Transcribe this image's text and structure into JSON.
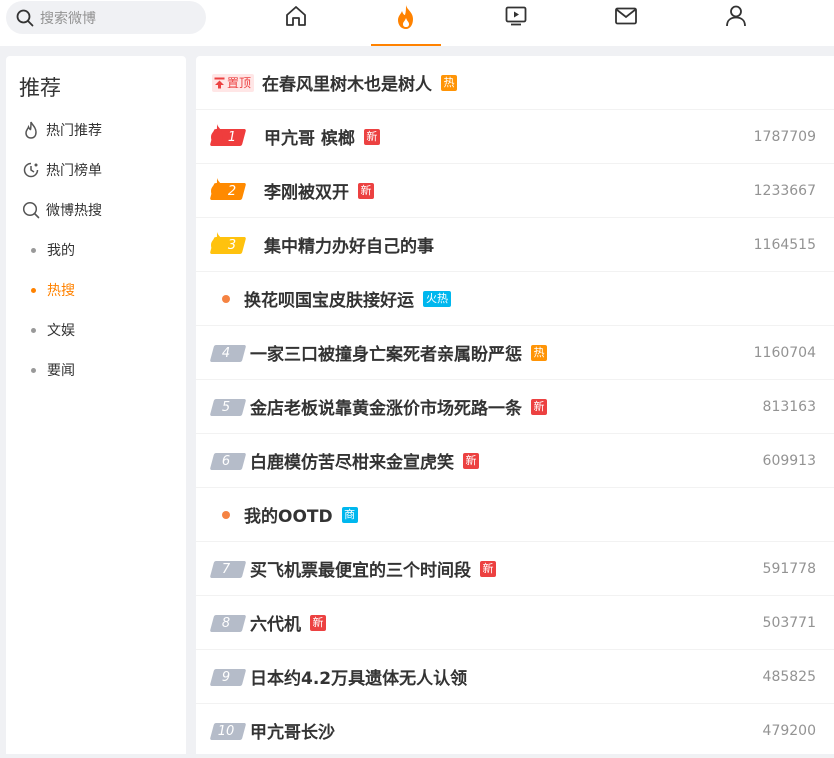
{
  "search": {
    "placeholder": "搜索微博"
  },
  "nav": {
    "icons": [
      "home-icon",
      "hot-fire-icon",
      "video-icon",
      "message-icon",
      "profile-icon"
    ],
    "active": "hot-fire-icon"
  },
  "sidebar": {
    "title": "推荐",
    "items": [
      {
        "label": "热门推荐",
        "icon": "fire-outline-icon"
      },
      {
        "label": "热门榜单",
        "icon": "clock-rank-icon"
      },
      {
        "label": "微博热搜",
        "icon": "search-hot-icon"
      },
      {
        "label": "我的"
      },
      {
        "label": "热搜",
        "active": true
      },
      {
        "label": "文娱"
      },
      {
        "label": "要闻"
      }
    ]
  },
  "hotlist": {
    "pinned": {
      "pin_label": "置顶",
      "title": "在春风里树木也是树人",
      "tag": "热"
    },
    "rows": [
      {
        "rank": "1",
        "title": "甲亢哥 槟榔",
        "tag": "新",
        "count": "1787709"
      },
      {
        "rank": "2",
        "title": "李刚被双开",
        "tag": "新",
        "count": "1233667"
      },
      {
        "rank": "3",
        "title": "集中精力办好自己的事",
        "tag": "",
        "count": "1164515"
      },
      {
        "rank": "",
        "title": "换花呗国宝皮肤接好运",
        "tag": "火热",
        "count": ""
      },
      {
        "rank": "4",
        "title": "一家三口被撞身亡案死者亲属盼严惩",
        "tag": "热",
        "count": "1160704"
      },
      {
        "rank": "5",
        "title": "金店老板说靠黄金涨价市场死路一条",
        "tag": "新",
        "count": "813163"
      },
      {
        "rank": "6",
        "title": "白鹿模仿苦尽柑来金宣虎笑",
        "tag": "新",
        "count": "609913"
      },
      {
        "rank": "",
        "title": "我的OOTD",
        "tag": "商",
        "count": ""
      },
      {
        "rank": "7",
        "title": "买飞机票最便宜的三个时间段",
        "tag": "新",
        "count": "591778"
      },
      {
        "rank": "8",
        "title": "六代机",
        "tag": "新",
        "count": "503771"
      },
      {
        "rank": "9",
        "title": "日本约4.2万具遗体无人认领",
        "tag": "",
        "count": "485825"
      },
      {
        "rank": "10",
        "title": "甲亢哥长沙",
        "tag": "",
        "count": "479200"
      }
    ]
  },
  "colors": {
    "accent": "#ff8200",
    "new_tag": "#ec4141",
    "hot_tag": "#ff9406",
    "fire_tag": "#00b7ee",
    "rank1": "#ef3d3d",
    "rank2": "#ff8a00",
    "rank3": "#ffc20e",
    "rank_other": "#b5bcc9"
  }
}
